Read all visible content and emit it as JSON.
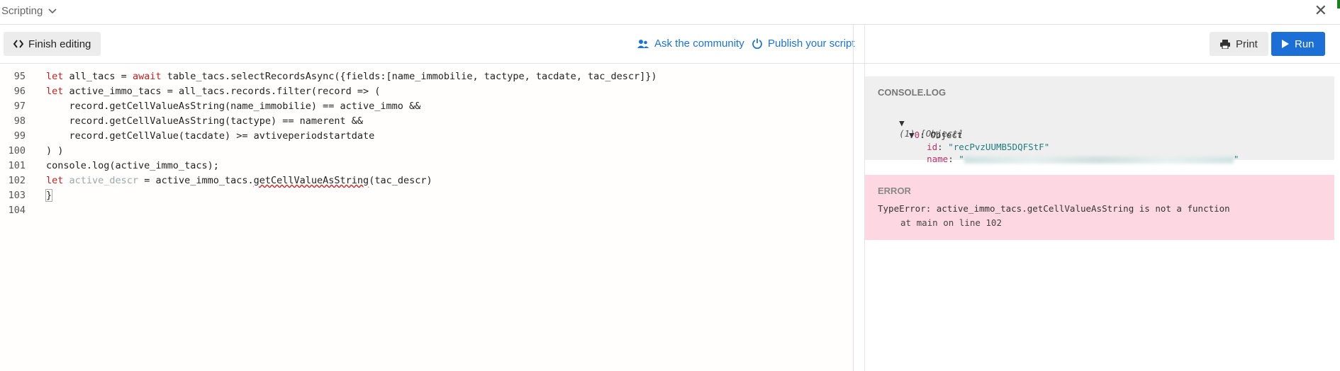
{
  "titlebar": {
    "title": "Scripting"
  },
  "toolbar": {
    "finish_label": "Finish editing",
    "community_label": "Ask the community",
    "publish_label": "Publish your script",
    "print_label": "Print",
    "run_label": "Run"
  },
  "editor": {
    "lines": [
      {
        "n": "95",
        "parts": [
          [
            "kw",
            "let"
          ],
          [
            "",
            "all_tacs = "
          ],
          [
            "kw",
            "await"
          ],
          [
            "",
            " table_tacs.selectRecordsAsync({fields:[name_immobilie, tactype, tacdate, tac_descr]})"
          ]
        ]
      },
      {
        "n": "96",
        "parts": [
          [
            "kw",
            "let"
          ],
          [
            "",
            " active_immo_tacs = all_tacs.records.filter(record => ("
          ]
        ]
      },
      {
        "n": "97",
        "parts": [
          [
            "",
            "    record.getCellValueAsString(name_immobilie) == active_immo &&"
          ]
        ]
      },
      {
        "n": "98",
        "parts": [
          [
            "",
            "    record.getCellValueAsString(tactype) == namerent &&"
          ]
        ]
      },
      {
        "n": "99",
        "parts": [
          [
            "",
            "    record.getCellValue(tacdate) >= avtiveperiodstartdate"
          ]
        ]
      },
      {
        "n": "100",
        "parts": [
          [
            "",
            ") )"
          ]
        ]
      },
      {
        "n": "101",
        "parts": [
          [
            "",
            "console.log(active_immo_tacs);"
          ]
        ]
      },
      {
        "n": "102",
        "parts": [
          [
            "kw",
            "let"
          ],
          [
            "faded",
            " active_descr"
          ],
          [
            "",
            " = active_immo_tacs."
          ],
          [
            "squiggle",
            "getCellValueAsString"
          ],
          [
            "",
            "(tac_descr)"
          ]
        ]
      },
      {
        "n": "103",
        "parts": [
          [
            "cursor-brace",
            "}"
          ]
        ]
      },
      {
        "n": "104",
        "parts": []
      }
    ]
  },
  "console": {
    "header": "CONSOLE.LOG",
    "summary": "(1) [Object]",
    "item_index": "0",
    "item_type": "Object",
    "id_key": "id",
    "id_value": "\"recPvzUUMB5DQFStF\"",
    "name_key": "name",
    "name_open": "\"",
    "name_close": "\""
  },
  "error": {
    "header": "ERROR",
    "message": "TypeError: active_immo_tacs.getCellValueAsString is not a function",
    "location": "at main on line 102"
  }
}
